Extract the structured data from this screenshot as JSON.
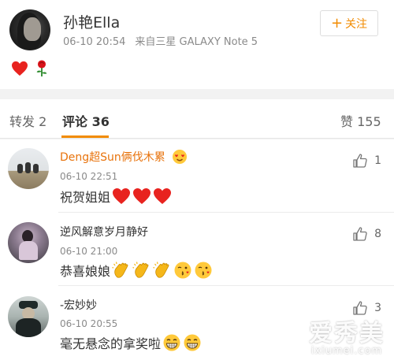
{
  "post": {
    "author": "孙艳Ella",
    "time": "06-10 20:54",
    "source": "来自三星 GALAXY Note 5",
    "follow_label": "关注",
    "content_emojis": [
      "heart-icon",
      "rose-icon"
    ]
  },
  "tabs": {
    "repost": "转发 2",
    "comments": "评论 36",
    "likes": "赞 155"
  },
  "comments": [
    {
      "name": "Deng超Sun俩伐木累",
      "name_color": "#e8730c",
      "badge": "heart-eyes-badge-icon",
      "time": "06-10 22:51",
      "text": "祝贺姐姐",
      "emojis": [
        "heart-icon",
        "heart-icon",
        "heart-icon"
      ],
      "likes": "1"
    },
    {
      "name": "逆风解意岁月静好",
      "name_color": "#333333",
      "time": "06-10 21:00",
      "text": "恭喜娘娘",
      "emojis": [
        "clap-icon",
        "clap-icon",
        "clap-icon",
        "kiss-icon",
        "kiss-icon"
      ],
      "likes": "8"
    },
    {
      "name": "-宏妙妙",
      "name_color": "#333333",
      "time": "06-10 20:55",
      "text": "毫无悬念的拿奖啦",
      "emojis": [
        "grin-icon",
        "grin-icon"
      ],
      "likes": "3"
    }
  ],
  "watermark": {
    "main": "爱秀美",
    "sub": "ixiumei.com"
  },
  "colors": {
    "accent": "#f28b00",
    "meta": "#8a8a8a",
    "background": "#f2f2f2"
  }
}
